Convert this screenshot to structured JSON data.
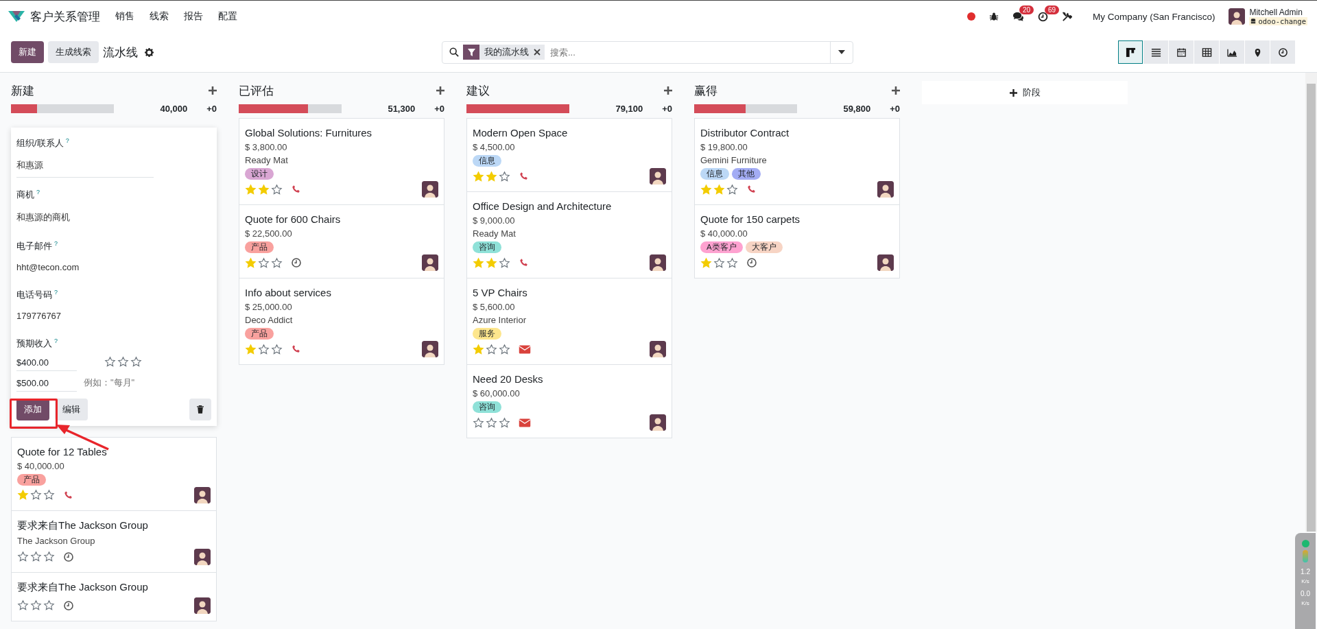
{
  "navbar": {
    "app_name": "客户关系管理",
    "menu": [
      "销售",
      "线索",
      "报告",
      "配置"
    ],
    "systray": [
      {
        "kind": "record"
      },
      {
        "kind": "bug"
      },
      {
        "kind": "chat",
        "badge": "20"
      },
      {
        "kind": "activity",
        "badge": "69"
      },
      {
        "kind": "tools"
      }
    ],
    "company": "My Company (San Francisco)",
    "user": "Mitchell Admin",
    "database": "odoo-change"
  },
  "control_panel": {
    "new_button": "新建",
    "generate_button": "生成线索",
    "breadcrumb": "流水线",
    "search": {
      "facet": "我的流水线",
      "placeholder": "搜索..."
    },
    "views": [
      {
        "kind": "kanban",
        "selected": true
      },
      {
        "kind": "list",
        "selected": false
      },
      {
        "kind": "calendar",
        "selected": false
      },
      {
        "kind": "pivot",
        "selected": false
      },
      {
        "kind": "graph",
        "selected": false
      },
      {
        "kind": "map",
        "selected": false
      },
      {
        "kind": "activity",
        "selected": false
      }
    ]
  },
  "columns": [
    {
      "title": "新建",
      "level": 0.25,
      "total": "40,000",
      "delta": "+0",
      "quick_create": {
        "fields": [
          {
            "kind": "input",
            "label": "组织/联系人",
            "help": "?",
            "value": "和惠源"
          },
          {
            "kind": "plain",
            "label": "商机",
            "help": "?",
            "value": "和惠源的商机"
          },
          {
            "kind": "plain",
            "label": "电子邮件",
            "help": "?",
            "value": "hht@tecon.com"
          },
          {
            "kind": "plain",
            "label": "电话号码",
            "help": "?",
            "value": "179776767"
          }
        ],
        "revenue": {
          "label": "预期收入",
          "help": "?",
          "value": "$400.00",
          "stars": 0,
          "recurring": "$500.00",
          "placeholder": "例如：\"每月\""
        },
        "add_button": "添加",
        "edit_button": "编辑",
        "highlighted": true
      },
      "cards": [
        {
          "title": "Quote for 12 Tables",
          "amount": "$ 40,000.00",
          "tags": [
            {
              "label": "产品",
              "color": "#f9a19e"
            }
          ],
          "stars": 1,
          "activity": {
            "kind": "phone"
          }
        },
        {
          "title": "要求来自The Jackson Group",
          "customer": "The Jackson Group",
          "stars": 0,
          "activity": {
            "kind": "clock"
          }
        },
        {
          "title": "要求来自The Jackson Group",
          "stars": 0,
          "activity": {
            "kind": "clock"
          }
        }
      ]
    },
    {
      "title": "已评估",
      "level": 0.67,
      "total": "51,300",
      "delta": "+0",
      "cards": [
        {
          "title": "Global Solutions: Furnitures",
          "amount": "$ 3,800.00",
          "customer": "Ready Mat",
          "tags": [
            {
              "label": "设计",
              "color": "#d9a6d3"
            }
          ],
          "stars": 2,
          "activity": {
            "kind": "phone"
          }
        },
        {
          "title": "Quote for 600 Chairs",
          "amount": "$ 22,500.00",
          "tags": [
            {
              "label": "产品",
              "color": "#f9a19e"
            }
          ],
          "stars": 1,
          "activity": {
            "kind": "clock"
          }
        },
        {
          "title": "Info about services",
          "amount": "$ 25,000.00",
          "customer": "Deco Addict",
          "tags": [
            {
              "label": "产品",
              "color": "#f9a19e"
            }
          ],
          "stars": 1,
          "activity": {
            "kind": "phone"
          }
        }
      ]
    },
    {
      "title": "建议",
      "level": 1,
      "total": "79,100",
      "delta": "+0",
      "cards": [
        {
          "title": "Modern Open Space",
          "amount": "$ 4,500.00",
          "tags": [
            {
              "label": "信息",
              "color": "#bcd8f6"
            }
          ],
          "stars": 2,
          "activity": {
            "kind": "phone"
          }
        },
        {
          "title": "Office Design and Architecture",
          "amount": "$ 9,000.00",
          "customer": "Ready Mat",
          "tags": [
            {
              "label": "咨询",
              "color": "#8fe1d8"
            }
          ],
          "stars": 2,
          "activity": {
            "kind": "phone"
          }
        },
        {
          "title": "5 VP Chairs",
          "amount": "$ 5,600.00",
          "customer": "Azure Interior",
          "tags": [
            {
              "label": "服务",
              "color": "#fde68d"
            }
          ],
          "stars": 1,
          "activity": {
            "kind": "email"
          }
        },
        {
          "title": "Need 20 Desks",
          "amount": "$ 60,000.00",
          "tags": [
            {
              "label": "咨询",
              "color": "#8fe1d8"
            }
          ],
          "stars": 0,
          "activity": {
            "kind": "email"
          }
        }
      ]
    },
    {
      "title": "赢得",
      "level": 0.5,
      "total": "59,800",
      "delta": "+0",
      "cards": [
        {
          "title": "Distributor Contract",
          "amount": "$ 19,800.00",
          "customer": "Gemini Furniture",
          "tags": [
            {
              "label": "信息",
              "color": "#bcd8f6"
            },
            {
              "label": "其他",
              "color": "#a3acf4"
            }
          ],
          "stars": 2,
          "activity": {
            "kind": "phone"
          }
        },
        {
          "title": "Quote for 150 carpets",
          "amount": "$ 40,000.00",
          "tags": [
            {
              "label": "A类客户",
              "color": "#fea2d0"
            },
            {
              "label": "大客户",
              "color": "#f7d4c4"
            }
          ],
          "stars": 1,
          "activity": {
            "kind": "clock"
          }
        }
      ]
    }
  ],
  "add_stage": "阶段",
  "network_monitor": {
    "upload": "1.2",
    "upload_unit": "K/s",
    "download": "0.0",
    "download_unit": "K/s"
  }
}
